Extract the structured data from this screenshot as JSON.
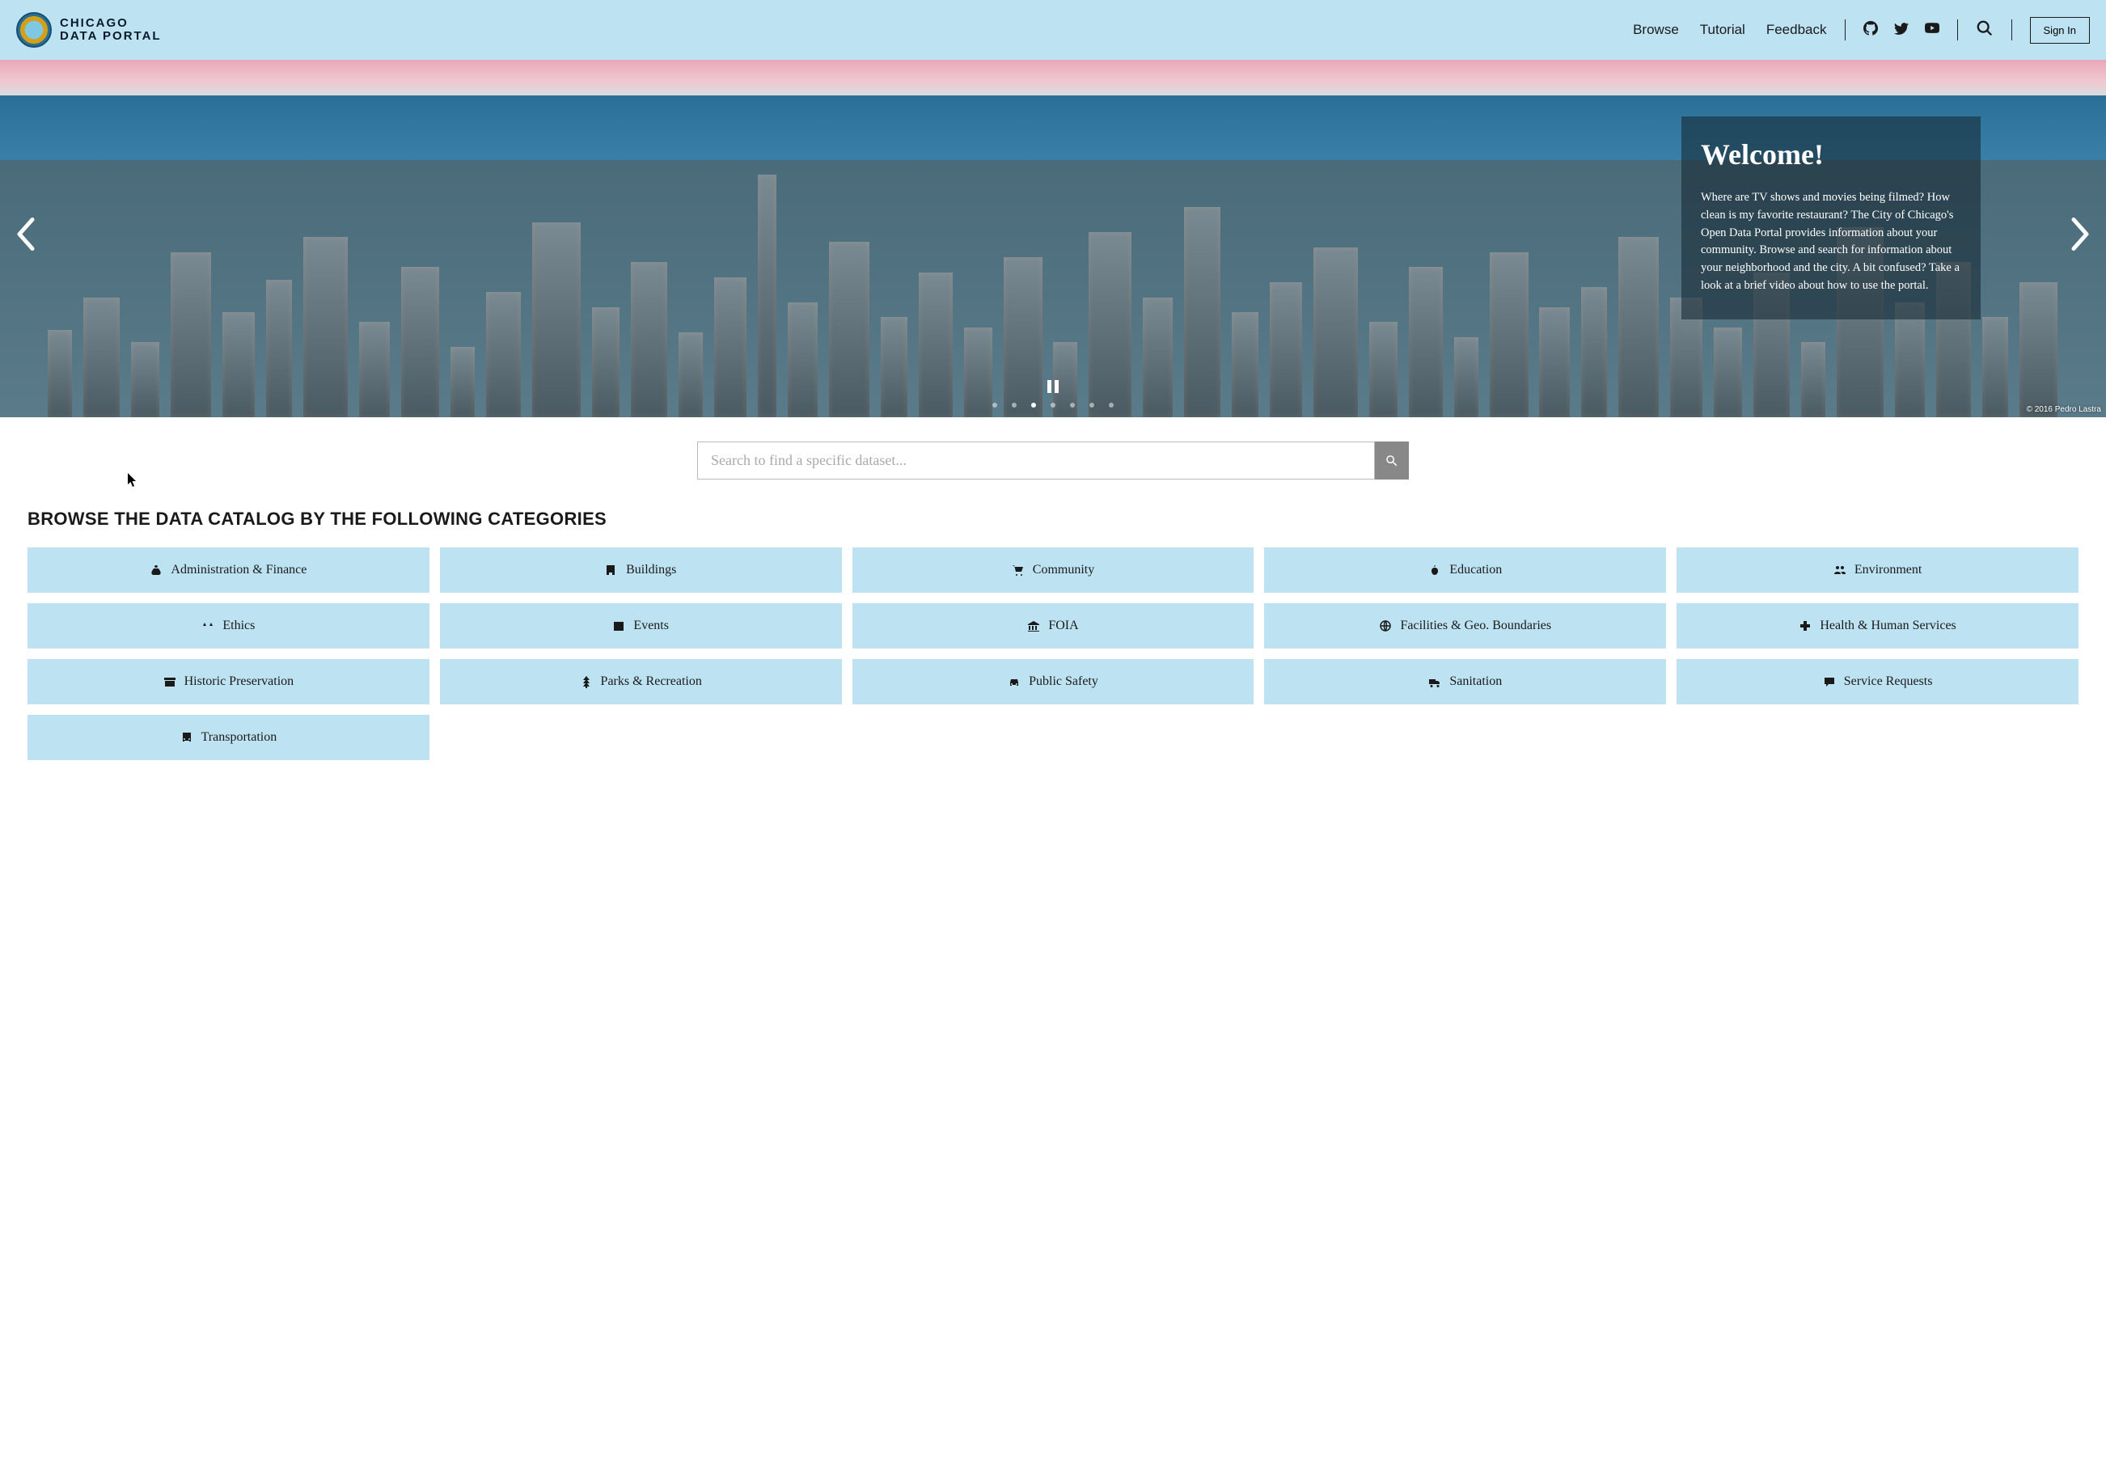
{
  "header": {
    "site_name_line1": "CHICAGO",
    "site_name_line2": "DATA PORTAL",
    "nav": {
      "browse": "Browse",
      "tutorial": "Tutorial",
      "feedback": "Feedback"
    },
    "sign_in": "Sign In"
  },
  "hero": {
    "title": "Welcome!",
    "body": "Where are TV shows and movies being filmed? How clean is my favorite restaurant? The City of Chicago's Open Data Portal provides information about your community. Browse and search for information about your neighborhood and the city. A bit confused? Take a look at a brief video about how to use the portal.",
    "credit": "© 2016 Pedro Lastra",
    "dot_count": 7,
    "active_dot": 2
  },
  "search": {
    "placeholder": "Search to find a specific dataset..."
  },
  "catalog": {
    "heading": "BROWSE THE DATA CATALOG BY THE FOLLOWING CATEGORIES",
    "categories": [
      {
        "id": "administration-finance",
        "label": "Administration & Finance",
        "icon": "money-bag"
      },
      {
        "id": "buildings",
        "label": "Buildings",
        "icon": "building"
      },
      {
        "id": "community",
        "label": "Community",
        "icon": "cart"
      },
      {
        "id": "education",
        "label": "Education",
        "icon": "apple"
      },
      {
        "id": "environment",
        "label": "Environment",
        "icon": "people"
      },
      {
        "id": "ethics",
        "label": "Ethics",
        "icon": "scales"
      },
      {
        "id": "events",
        "label": "Events",
        "icon": "calendar"
      },
      {
        "id": "foia",
        "label": "FOIA",
        "icon": "institution"
      },
      {
        "id": "facilities-geo-boundaries",
        "label": "Facilities & Geo. Boundaries",
        "icon": "globe"
      },
      {
        "id": "health-human-services",
        "label": "Health & Human Services",
        "icon": "medical"
      },
      {
        "id": "historic-preservation",
        "label": "Historic Preservation",
        "icon": "archive"
      },
      {
        "id": "parks-recreation",
        "label": "Parks & Recreation",
        "icon": "tree"
      },
      {
        "id": "public-safety",
        "label": "Public Safety",
        "icon": "car"
      },
      {
        "id": "sanitation",
        "label": "Sanitation",
        "icon": "truck"
      },
      {
        "id": "service-requests",
        "label": "Service Requests",
        "icon": "chat"
      },
      {
        "id": "transportation",
        "label": "Transportation",
        "icon": "bus"
      }
    ]
  }
}
